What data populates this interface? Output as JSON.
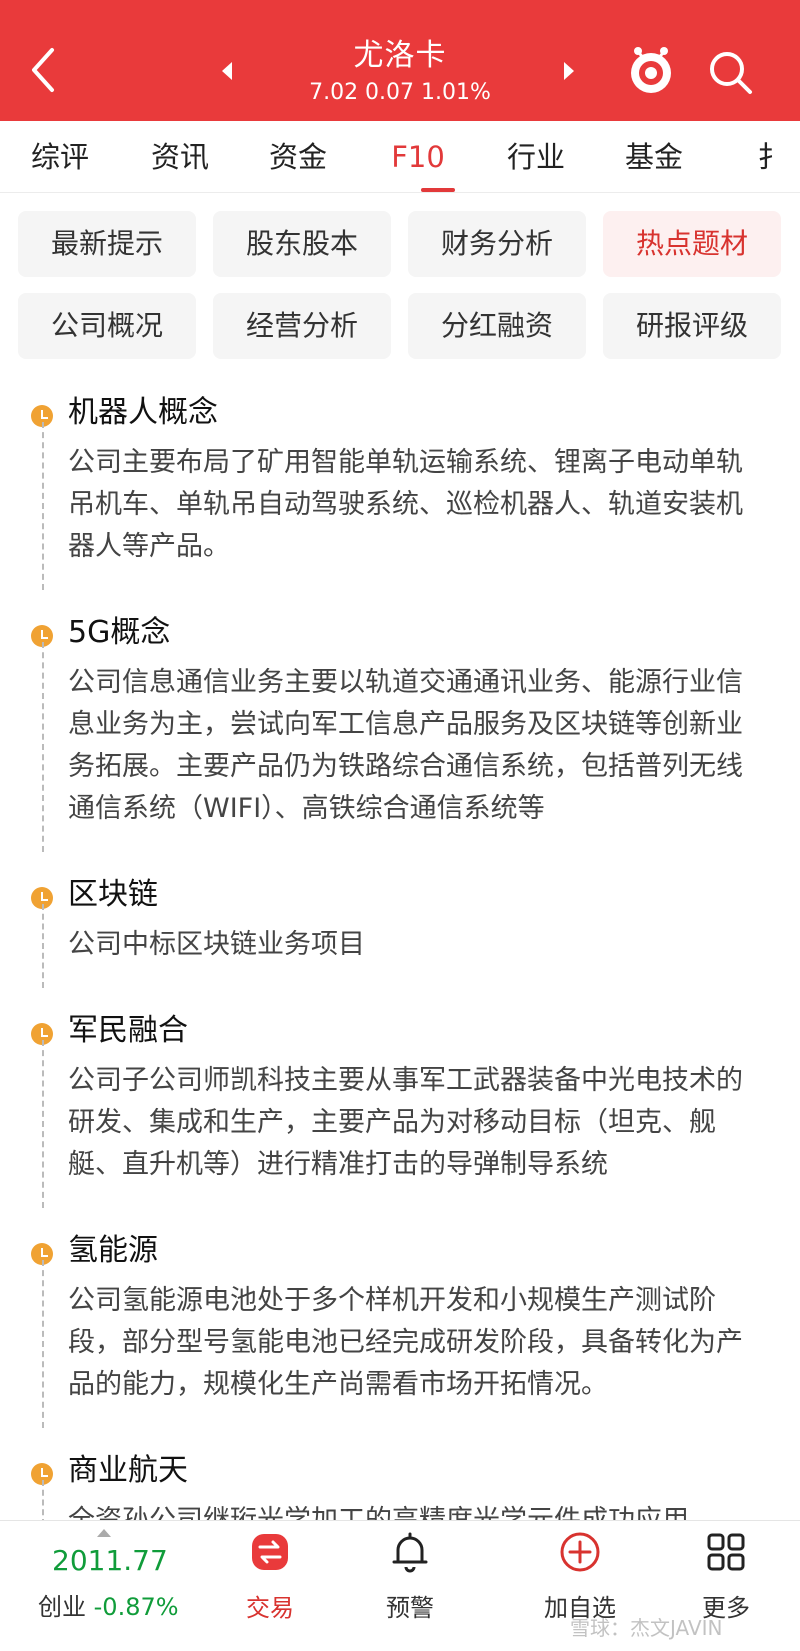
{
  "header": {
    "title": "尤洛卡",
    "quote": "7.02  0.07  1.01%",
    "back_icon": "chevron-left-icon",
    "search_icon": "search-icon",
    "colors": {
      "bg": "#e93a3b",
      "accent": "#e2393a"
    }
  },
  "tabs": [
    {
      "label": "综评"
    },
    {
      "label": "资讯"
    },
    {
      "label": "资金"
    },
    {
      "label": "F10",
      "active": true
    },
    {
      "label": "行业"
    },
    {
      "label": "基金"
    },
    {
      "label": "扌"
    }
  ],
  "sub_buttons": [
    {
      "label": "最新提示"
    },
    {
      "label": "股东股本"
    },
    {
      "label": "财务分析"
    },
    {
      "label": "热点题材",
      "active": true
    },
    {
      "label": "公司概况"
    },
    {
      "label": "经营分析"
    },
    {
      "label": "分红融资"
    },
    {
      "label": "研报评级"
    }
  ],
  "topics": [
    {
      "title": "机器人概念",
      "text": "公司主要布局了矿用智能单轨运输系统、锂离子电动单轨吊机车、单轨吊自动驾驶系统、巡检机器人、轨道安装机器人等产品。"
    },
    {
      "title": "5G概念",
      "text": "公司信息通信业务主要以轨道交通通讯业务、能源行业信息业务为主，尝试向军工信息产品服务及区块链等创新业务拓展。主要产品仍为铁路综合通信系统，包括普列无线通信系统（WIFI）、高铁综合通信系统等"
    },
    {
      "title": "区块链",
      "text": "公司中标区块链业务项目"
    },
    {
      "title": "军民融合",
      "text": "公司子公司师凯科技主要从事军工武器装备中光电技术的研发、集成和生产，主要产品为对移动目标（坦克、舰艇、直升机等）进行精准打击的导弹制导系统"
    },
    {
      "title": "氢能源",
      "text": "公司氢能源电池处于多个样机开发和小规模生产测试阶段，部分型号氢能电池已经完成研发阶段，具备转化为产品的能力，规模化生产尚需看市场开拓情况。"
    },
    {
      "title": "商业航天",
      "text": "全资孙公司继珩光学加工的高精度光学元件成功应用"
    }
  ],
  "bottom": {
    "index_value": "2011.77",
    "index_name": "创业",
    "index_change": "-0.87%",
    "nav": [
      {
        "label": "交易",
        "icon": "trade-icon"
      },
      {
        "label": "预警",
        "icon": "bell-icon"
      },
      {
        "label": "加自选",
        "icon": "add-circle-icon"
      },
      {
        "label": "更多",
        "icon": "grid-icon"
      }
    ],
    "watermark": "雪球：杰文JAVIN"
  }
}
